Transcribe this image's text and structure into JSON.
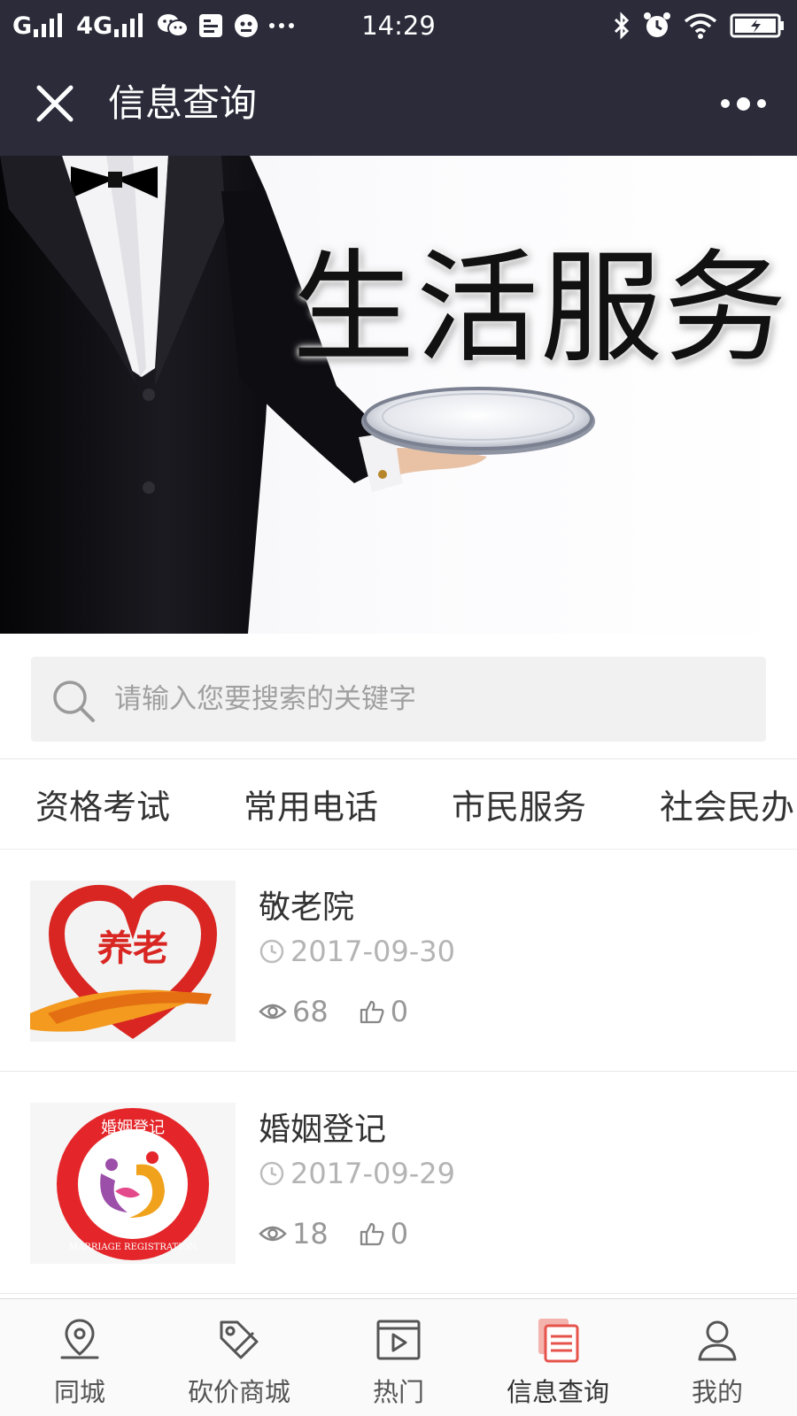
{
  "status_bar": {
    "signal_text": "G",
    "network_text": "4G",
    "time": "14:29"
  },
  "header": {
    "title": "信息查询",
    "close_icon": "close-icon",
    "more_icon": "more-dots-icon"
  },
  "banner": {
    "title": "生活服务"
  },
  "search": {
    "placeholder": "请输入您要搜索的关键字"
  },
  "tabs": [
    {
      "label": "资格考试"
    },
    {
      "label": "常用电话"
    },
    {
      "label": "市民服务"
    },
    {
      "label": "社会民办"
    }
  ],
  "items": [
    {
      "title": "敬老院",
      "date": "2017-09-30",
      "views": "68",
      "likes": "0",
      "thumb_text": "养老"
    },
    {
      "title": "婚姻登记",
      "date": "2017-09-29",
      "views": "18",
      "likes": "0",
      "thumb_text": "婚姻登记",
      "thumb_subtext": "MARRIAGE REGISTRATION"
    }
  ],
  "nav": [
    {
      "label": "同城",
      "icon": "location-icon"
    },
    {
      "label": "砍价商城",
      "icon": "tag-icon"
    },
    {
      "label": "热门",
      "icon": "video-play-icon"
    },
    {
      "label": "信息查询",
      "icon": "documents-icon",
      "active": true
    },
    {
      "label": "我的",
      "icon": "user-icon"
    }
  ],
  "colors": {
    "header_bg": "#2b2b3a",
    "active_icon": "#e5534b",
    "heart_red": "#d92622",
    "heart_orange": "#f39a1f"
  }
}
